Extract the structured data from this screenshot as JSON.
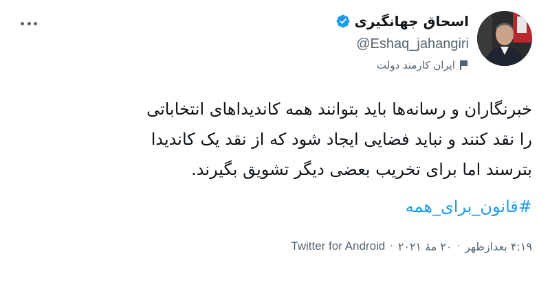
{
  "user": {
    "display_name": "اسحاق جهانگیری",
    "handle": "@Eshaq_jahangiri",
    "affiliation": "ایران کارمند دولت",
    "verified_color": "#1d9bf0"
  },
  "tweet": {
    "lines": [
      "خبرنگاران و رسانه‌ها باید بتوانند همه کاندیداهای انتخاباتی",
      "را نقد کنند و نباید فضایی ایجاد شود که از نقد یک کاندیدا",
      "بترسند اما برای تخریب بعضی دیگر تشویق بگیرند."
    ],
    "hashtag": "#قانون_برای_همه"
  },
  "meta": {
    "time": "۴:۱۹ بعدازظهر",
    "separator": "·",
    "date": "۲۰ مهٔ ۲۰۲۱",
    "source": "Twitter for Android"
  },
  "icons": {
    "more": "more-dots-icon",
    "verified": "verified-badge-icon",
    "flag": "flag-icon"
  },
  "colors": {
    "accent": "#1d9bf0",
    "text": "#0f1419",
    "secondary": "#536471"
  }
}
